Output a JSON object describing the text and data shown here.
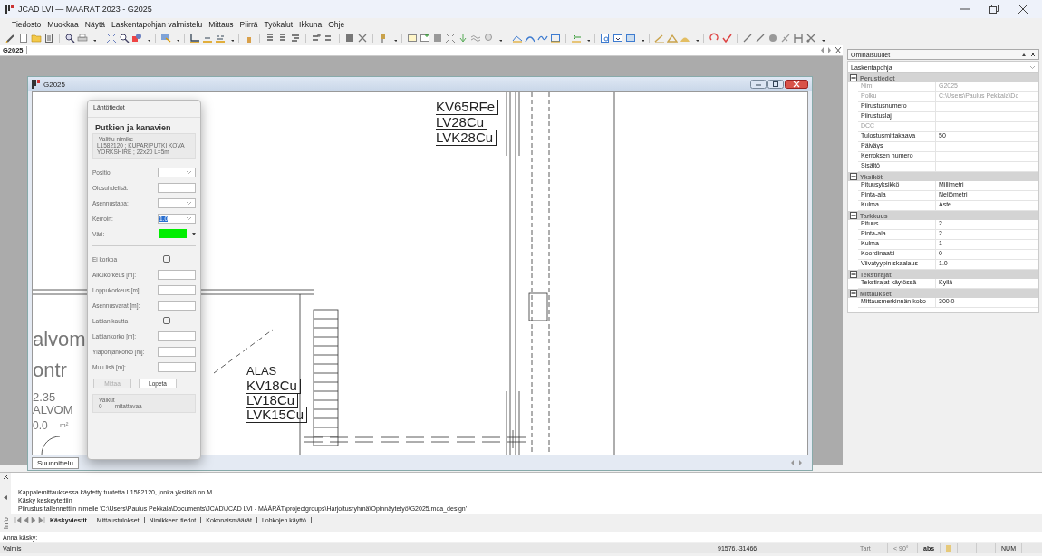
{
  "window": {
    "title": "JCAD LVI — MÄÄRÄT 2023 - G2025"
  },
  "menu": [
    "Tiedosto",
    "Muokkaa",
    "Näytä",
    "Laskentapohjan valmistelu",
    "Mittaus",
    "Piirrä",
    "Työkalut",
    "Ikkuna",
    "Ohje"
  ],
  "document_tab": {
    "label": "G2025"
  },
  "drawing_window": {
    "title": "G2025",
    "labels": [
      {
        "text": "KV65RFe",
        "kind": "pipe"
      },
      {
        "text": "LV28Cu",
        "kind": "pipe"
      },
      {
        "text": "LVK28Cu",
        "kind": "pipe"
      },
      {
        "text": "ALAS",
        "kind": "plain"
      },
      {
        "text": "KV18Cu",
        "kind": "pipe"
      },
      {
        "text": "LV18Cu",
        "kind": "pipe"
      },
      {
        "text": "LVK15Cu",
        "kind": "pipe"
      },
      {
        "text": "alvom",
        "kind": "room"
      },
      {
        "text": "ontr",
        "kind": "room"
      },
      {
        "text": "2.35",
        "kind": "room-small"
      },
      {
        "text": "ALVOM",
        "kind": "room-small"
      },
      {
        "text": "0.0",
        "kind": "room-small"
      },
      {
        "text": "m²",
        "kind": "room-tiny"
      }
    ],
    "layout_tab": "Suunnittelu"
  },
  "dialog": {
    "title": "Lähtötiedot",
    "heading": "Putkien ja kanavien",
    "item_group": "Valittu nimike",
    "item": "L1582120 ; KUPARIPUTKI KOVA YORKSHIRE ; 22x20 L=5m",
    "fields": [
      {
        "label": "Positio:",
        "kind": "select"
      },
      {
        "label": "Olosuhdelisä:",
        "kind": "input"
      },
      {
        "label": "Asennustapa:",
        "kind": "select"
      },
      {
        "label": "Kerroin:",
        "kind": "select",
        "value": "1.0",
        "focused": true
      },
      {
        "label": "Väri:",
        "kind": "color",
        "color": "#00ee00"
      },
      {
        "kind": "divider"
      },
      {
        "label": "Ei korkoa",
        "kind": "checkbox",
        "checked": false
      },
      {
        "label": "Alkukorkeus [m]:",
        "kind": "input"
      },
      {
        "label": "Loppukorkeus [m]:",
        "kind": "input"
      },
      {
        "label": "Asennusvarat [m]:",
        "kind": "input"
      },
      {
        "label": "Lattian kautta",
        "kind": "checkbox",
        "checked": false
      },
      {
        "label": "Lattiankorko [m]:",
        "kind": "input"
      },
      {
        "label": "Yläpohjankorko [m]:",
        "kind": "input"
      },
      {
        "label": "Muu lisä [m]:",
        "kind": "input"
      }
    ],
    "buttons": [
      {
        "label": "Mittaa",
        "disabled": true
      },
      {
        "label": "Lopeta",
        "disabled": false
      }
    ],
    "result_group": "Vaikut",
    "result_count": "0",
    "result_text": "mitattavaa"
  },
  "properties": {
    "title": "Ominaisuudet",
    "selector": "Laskentapohja",
    "groups": [
      {
        "title": "Perustiedot",
        "expanded": true,
        "rows": [
          {
            "name": "Nimi",
            "value": "G2025",
            "disabled": true
          },
          {
            "name": "Polku",
            "value": "C:\\Users\\Paulus Pekkala\\Do",
            "disabled": true
          },
          {
            "name": "Piirustusnumero",
            "disabled": false
          },
          {
            "name": "Piirustuslaji",
            "disabled": false
          },
          {
            "name": "DCC",
            "disabled": true
          },
          {
            "name": "Tulostusmittakaava",
            "value": "50",
            "disabled": false
          },
          {
            "name": "Päiväys",
            "disabled": false
          },
          {
            "name": "Kerroksen numero",
            "disabled": false
          },
          {
            "name": "Sisältö",
            "disabled": false
          }
        ]
      },
      {
        "title": "Yksiköt",
        "expanded": true,
        "rows": [
          {
            "name": "Pituusyksikkö",
            "value": "Millimetri",
            "disabled": false
          },
          {
            "name": "Pinta-ala",
            "value": "Neliömetri",
            "disabled": false
          },
          {
            "name": "Kulma",
            "value": "Aste",
            "disabled": false
          }
        ]
      },
      {
        "title": "Tarkkuus",
        "expanded": true,
        "rows": [
          {
            "name": "Pituus",
            "value": "2",
            "disabled": false
          },
          {
            "name": "Pinta-ala",
            "value": "2",
            "disabled": false
          },
          {
            "name": "Kulma",
            "value": "1",
            "disabled": false
          },
          {
            "name": "Koordinaatti",
            "value": "0",
            "disabled": false
          },
          {
            "name": "Viivatyypin skaalaus",
            "value": "1.0",
            "disabled": false
          }
        ]
      },
      {
        "title": "Tekstirajat",
        "expanded": true,
        "rows": [
          {
            "name": "Tekstirajat käytössä",
            "value": "Kyllä",
            "disabled": false
          }
        ]
      },
      {
        "title": "Mittaukset",
        "expanded": true,
        "rows": [
          {
            "name": "Mittausmerkinnän koko",
            "value": "300.0",
            "disabled": false
          }
        ]
      }
    ]
  },
  "output": {
    "side_label": "Info",
    "lines": [
      "Kappalemittauksessa käytetty tuotetta L1582120, jonka yksikkö on M.",
      "Käsky keskeytettiin",
      "Piirustus tallennettiin nimelle 'C:\\Users\\Paulus Pekkala\\Documents\\JCAD\\JCAD LVI - MÄÄRÄT\\projectgroups\\Harjoitusryhmä\\Opinnäytetyö\\G2025.mqa_design'"
    ],
    "tabs": [
      {
        "label": "Käskyviestit",
        "selected": true
      },
      {
        "label": "Mittaustulokset",
        "selected": false
      },
      {
        "label": "Nimikkeen tiedot",
        "selected": false
      },
      {
        "label": "Kokonaismäärät",
        "selected": false
      },
      {
        "label": "Lohkojen käyttö",
        "selected": false
      }
    ]
  },
  "command": {
    "prompt": "Anna käsky:"
  },
  "status_bar": {
    "message": "Valmis",
    "coordinates": "91576,-31466",
    "snap": "Tart",
    "angle": "< 90°",
    "mode": "abs",
    "num": "NUM"
  }
}
